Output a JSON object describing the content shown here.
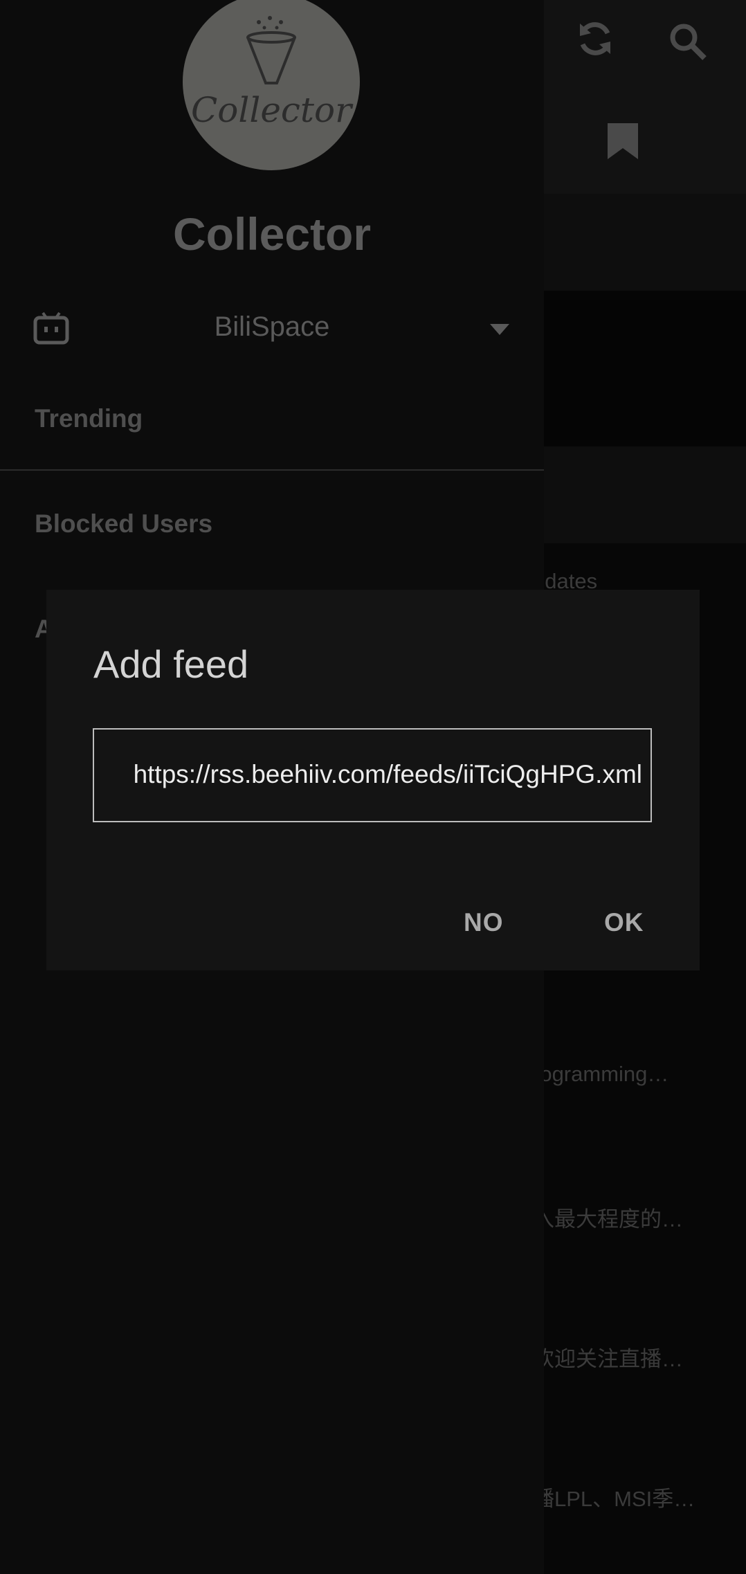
{
  "background": {
    "partial_texts": [
      "odates",
      "rogramming…",
      "入最大程度的…",
      "欢迎关注直播…",
      "播LPL、MSI季…"
    ],
    "icons": [
      "refresh-icon",
      "search-icon",
      "bookmark-icon"
    ]
  },
  "drawer": {
    "logo_text": "Collector",
    "app_name": "Collector",
    "source": {
      "label": "BiliSpace",
      "icon": "bilibili-icon"
    },
    "items": [
      {
        "label": "Trending"
      },
      {
        "label": "Blocked Users"
      },
      {
        "label": "A"
      }
    ]
  },
  "dialog": {
    "title": "Add feed",
    "url_value": "https://rss.beehiiv.com/feeds/iiTciQgHPG.xml",
    "no_label": "NO",
    "ok_label": "OK"
  }
}
